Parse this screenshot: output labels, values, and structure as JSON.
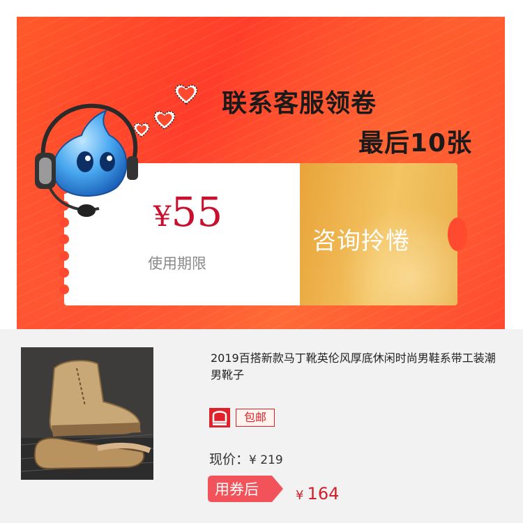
{
  "banner": {
    "headline_1": "联系客服领卷",
    "headline_2": "最后10张",
    "coupon": {
      "currency": "¥",
      "amount": "55",
      "validity_label": "使用期限",
      "claim_label": "咨询拎惓"
    }
  },
  "product": {
    "title": "2019百搭新款马丁靴英伦风厚底休闲时尚男鞋系带工装潮男靴子",
    "free_shipping_badge": "包邮",
    "current_price_label": "现价：",
    "current_price": "¥ 219",
    "after_coupon_label": "用券后",
    "final_price_currency": "¥",
    "final_price": "164"
  },
  "colors": {
    "banner_red": "#ff4a2f",
    "coupon_price_red": "#c8102e",
    "badge_red": "#e0202a",
    "claim_gold": "#f3c463"
  }
}
